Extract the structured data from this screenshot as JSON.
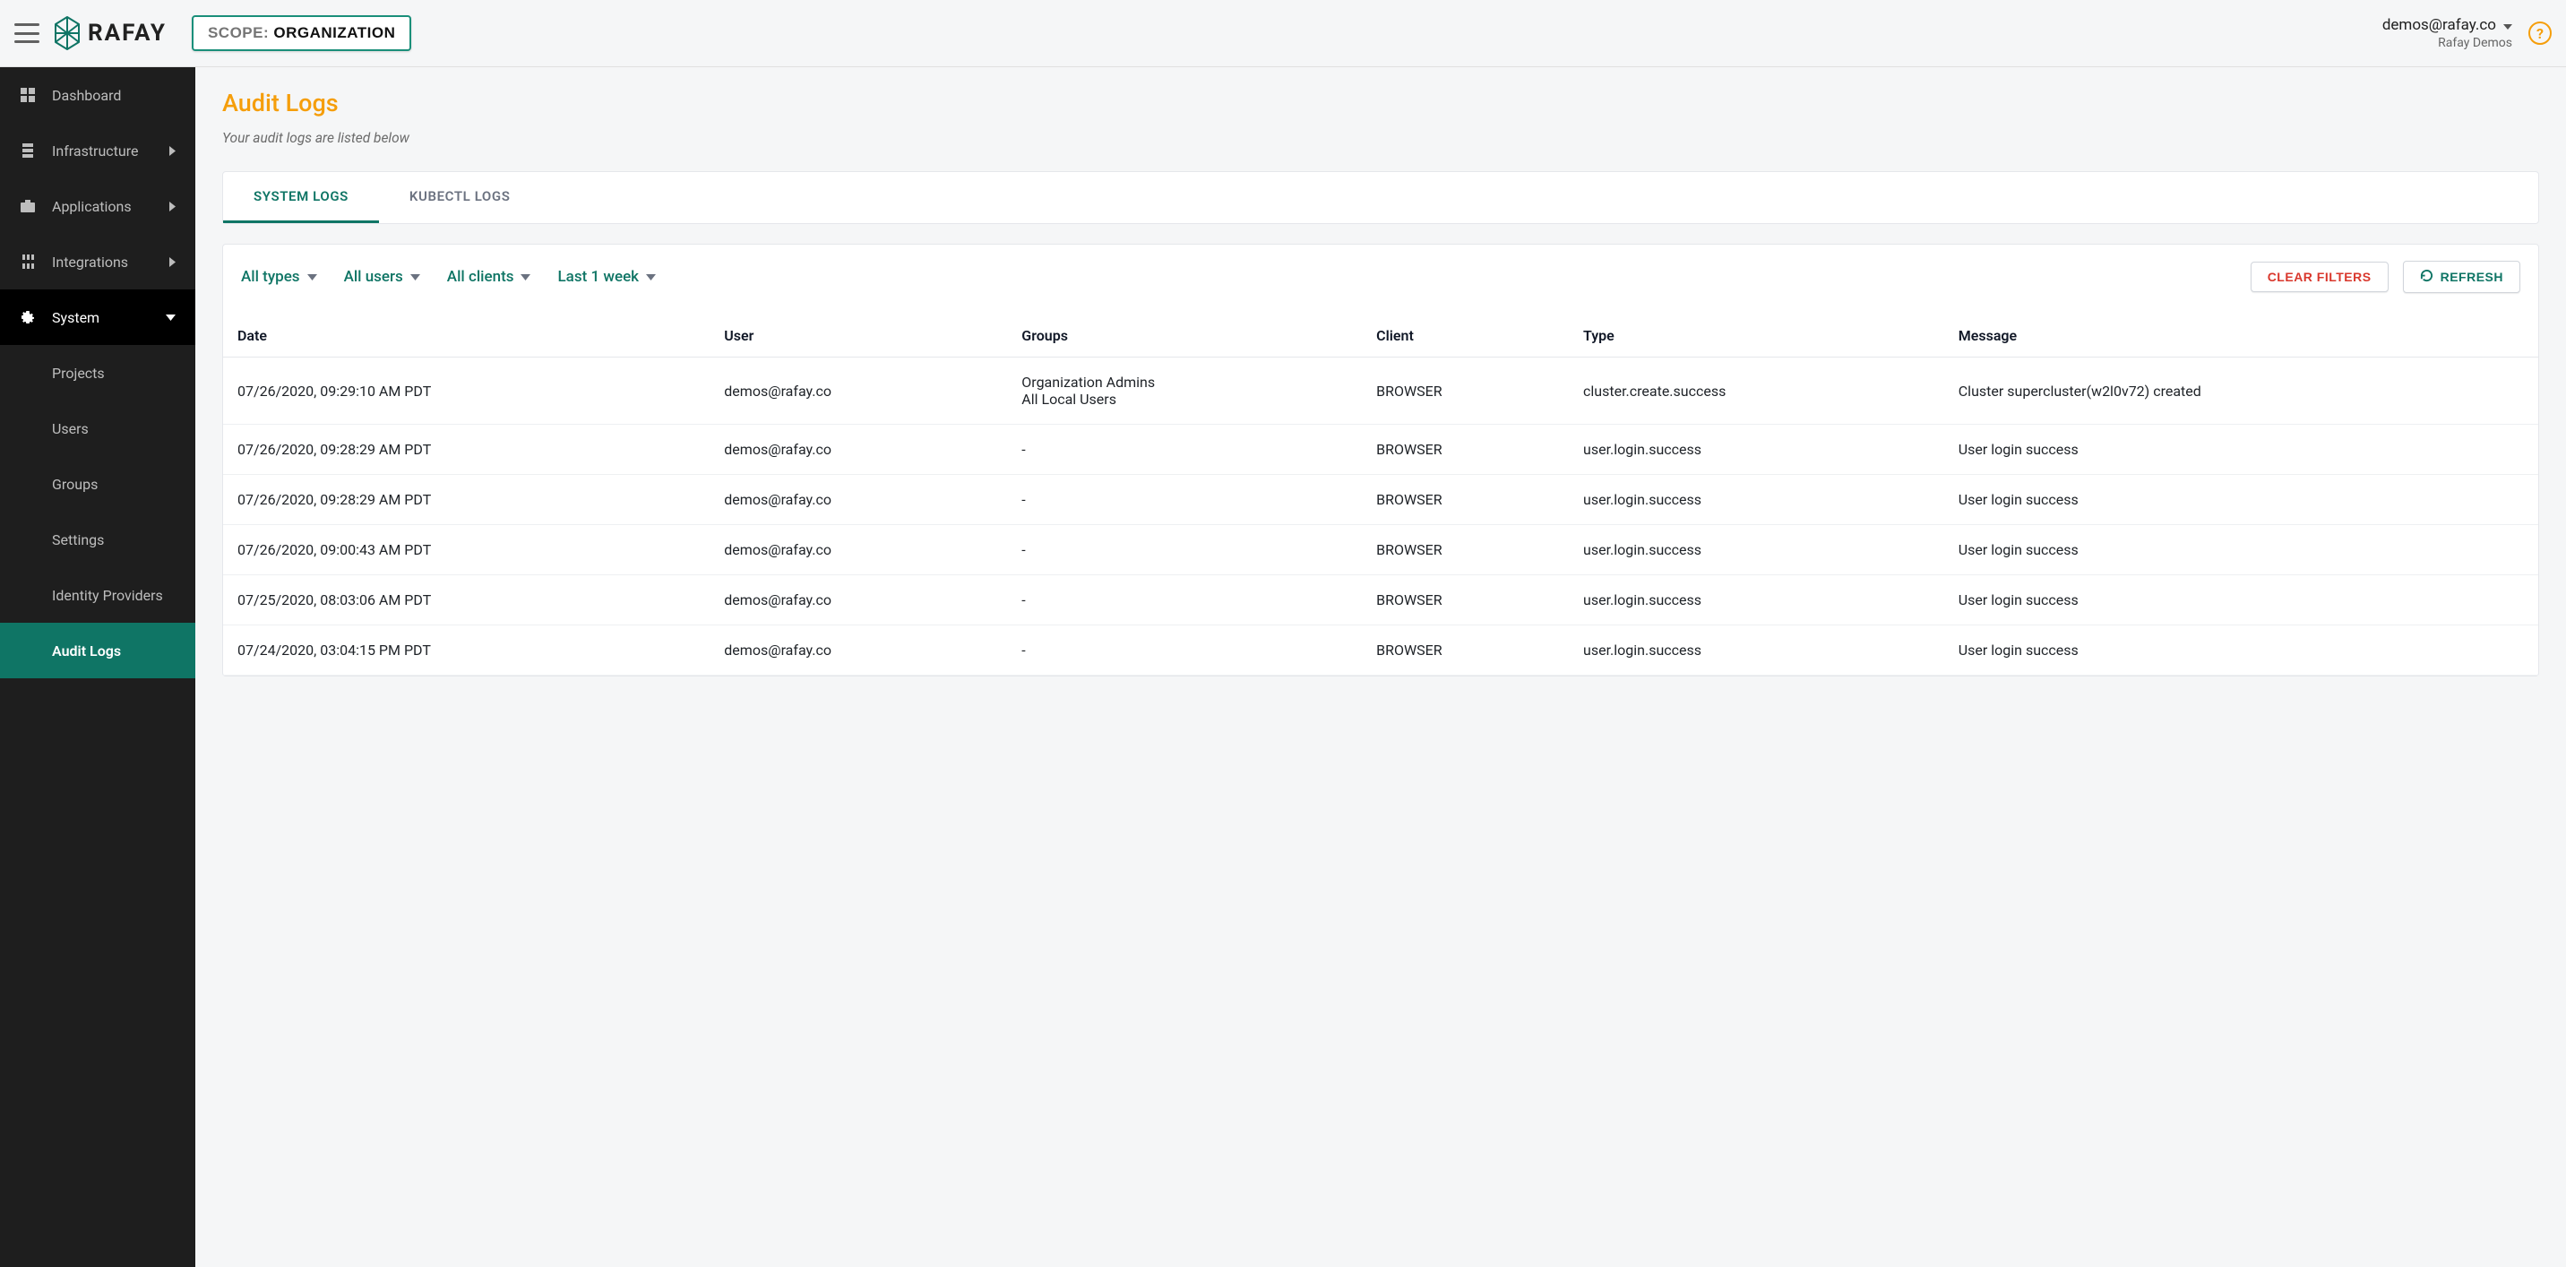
{
  "header": {
    "brand_text": "RAFAY",
    "scope_label": "SCOPE: ",
    "scope_value": "ORGANIZATION",
    "account_email": "demos@rafay.co",
    "account_org": "Rafay Demos",
    "help_glyph": "?"
  },
  "sidebar": {
    "items": [
      {
        "label": "Dashboard",
        "has_children": false
      },
      {
        "label": "Infrastructure",
        "has_children": true
      },
      {
        "label": "Applications",
        "has_children": true
      },
      {
        "label": "Integrations",
        "has_children": true
      },
      {
        "label": "System",
        "has_children": true,
        "active": true,
        "children": [
          {
            "label": "Projects"
          },
          {
            "label": "Users"
          },
          {
            "label": "Groups"
          },
          {
            "label": "Settings"
          },
          {
            "label": "Identity Providers"
          },
          {
            "label": "Audit Logs",
            "selected": true
          }
        ]
      }
    ]
  },
  "page": {
    "title": "Audit Logs",
    "subtitle": "Your audit logs are listed below"
  },
  "tabs": [
    {
      "label": "SYSTEM LOGS",
      "active": true
    },
    {
      "label": "KUBECTL LOGS",
      "active": false
    }
  ],
  "filters": {
    "type": "All types",
    "user": "All users",
    "client": "All clients",
    "range": "Last 1 week"
  },
  "buttons": {
    "clear": "CLEAR FILTERS",
    "refresh": "REFRESH"
  },
  "table": {
    "columns": [
      "Date",
      "User",
      "Groups",
      "Client",
      "Type",
      "Message"
    ],
    "rows": [
      {
        "date": "07/26/2020, 09:29:10 AM PDT",
        "user": "demos@rafay.co",
        "groups": "Organization Admins\nAll Local Users",
        "client": "BROWSER",
        "type": "cluster.create.success",
        "message": "Cluster supercluster(w2l0v72) created"
      },
      {
        "date": "07/26/2020, 09:28:29 AM PDT",
        "user": "demos@rafay.co",
        "groups": "-",
        "client": "BROWSER",
        "type": "user.login.success",
        "message": "User login success"
      },
      {
        "date": "07/26/2020, 09:28:29 AM PDT",
        "user": "demos@rafay.co",
        "groups": "-",
        "client": "BROWSER",
        "type": "user.login.success",
        "message": "User login success"
      },
      {
        "date": "07/26/2020, 09:00:43 AM PDT",
        "user": "demos@rafay.co",
        "groups": "-",
        "client": "BROWSER",
        "type": "user.login.success",
        "message": "User login success"
      },
      {
        "date": "07/25/2020, 08:03:06 AM PDT",
        "user": "demos@rafay.co",
        "groups": "-",
        "client": "BROWSER",
        "type": "user.login.success",
        "message": "User login success"
      },
      {
        "date": "07/24/2020, 03:04:15 PM PDT",
        "user": "demos@rafay.co",
        "groups": "-",
        "client": "BROWSER",
        "type": "user.login.success",
        "message": "User login success"
      }
    ]
  }
}
